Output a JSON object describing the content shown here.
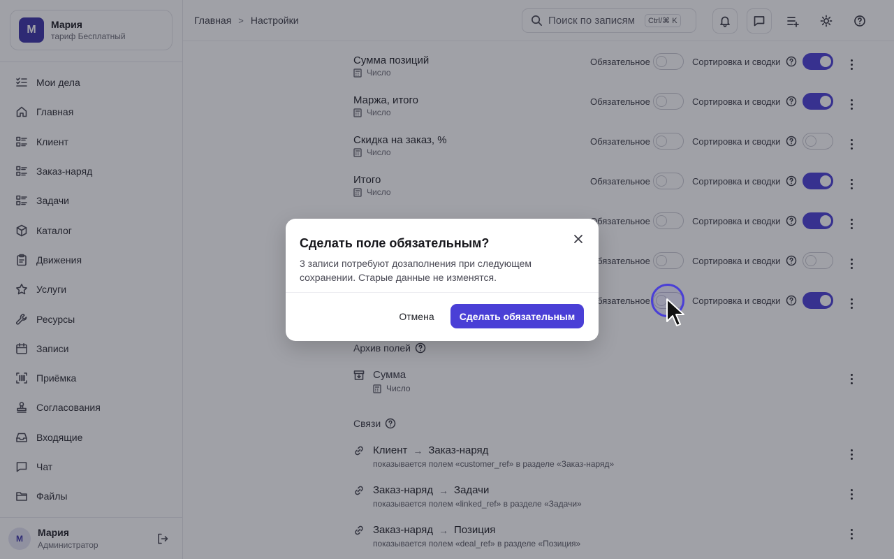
{
  "workspace": {
    "avatar": "М",
    "name": "Мария",
    "plan": "тариф Бесплатный"
  },
  "nav": [
    {
      "label": "Мои дела",
      "icon": "checklist-icon"
    },
    {
      "label": "Главная",
      "icon": "home-icon"
    },
    {
      "label": "Клиент",
      "icon": "list-icon"
    },
    {
      "label": "Заказ-наряд",
      "icon": "list-icon"
    },
    {
      "label": "Задачи",
      "icon": "list-icon"
    },
    {
      "label": "Каталог",
      "icon": "box-icon"
    },
    {
      "label": "Движения",
      "icon": "clipboard-icon"
    },
    {
      "label": "Услуги",
      "icon": "star-icon"
    },
    {
      "label": "Ресурсы",
      "icon": "wrench-icon"
    },
    {
      "label": "Записи",
      "icon": "calendar-icon"
    },
    {
      "label": "Приёмка",
      "icon": "barcode-icon"
    },
    {
      "label": "Согласования",
      "icon": "stamp-icon"
    },
    {
      "label": "Входящие",
      "icon": "inbox-icon"
    },
    {
      "label": "Чат",
      "icon": "chat-icon"
    },
    {
      "label": "Файлы",
      "icon": "folder-icon"
    }
  ],
  "user": {
    "avatar": "М",
    "name": "Мария",
    "role": "Администратор"
  },
  "breadcrumb": {
    "home": "Главная",
    "current": "Настройки"
  },
  "search": {
    "placeholder": "Поиск по записям",
    "shortcut": "Ctrl/⌘ K"
  },
  "labels": {
    "required": "Обязательное",
    "sort": "Сортировка и сводки",
    "number_type": "Число"
  },
  "fields": [
    {
      "name": "Сумма позиций",
      "type": "Число",
      "required": false,
      "sort": true
    },
    {
      "name": "Маржа, итого",
      "type": "Число",
      "required": false,
      "sort": true
    },
    {
      "name": "Скидка на заказ, %",
      "type": "Число",
      "required": false,
      "sort": false
    },
    {
      "name": "Итого",
      "type": "Число",
      "required": false,
      "sort": true
    },
    {
      "name": "",
      "type": "",
      "required": false,
      "sort": true
    },
    {
      "name": "",
      "type": "",
      "required": false,
      "sort": false
    },
    {
      "name": "",
      "type": "",
      "required": false,
      "sort": true
    }
  ],
  "archive": {
    "title": "Архив полей",
    "items": [
      {
        "name": "Сумма",
        "type": "Число"
      }
    ]
  },
  "links": {
    "title": "Связи",
    "items": [
      {
        "from": "Клиент",
        "to": "Заказ-наряд",
        "desc": "показывается полем «customer_ref» в разделе «Заказ-наряд»"
      },
      {
        "from": "Заказ-наряд",
        "to": "Задачи",
        "desc": "показывается полем «linked_ref» в разделе «Задачи»"
      },
      {
        "from": "Заказ-наряд",
        "to": "Позиция",
        "desc": "показывается полем «deal_ref» в разделе «Позиция»"
      }
    ]
  },
  "dialog": {
    "title": "Сделать поле обязательным?",
    "body": "3 записи потребуют дозаполнения при следующем сохранении. Старые данные не изменятся.",
    "cancel": "Отмена",
    "confirm": "Сделать обязательным"
  },
  "colors": {
    "accent": "#4a3fd6",
    "avatar": "#3c33a8",
    "overlay": "rgba(28,30,46,0.42)"
  }
}
